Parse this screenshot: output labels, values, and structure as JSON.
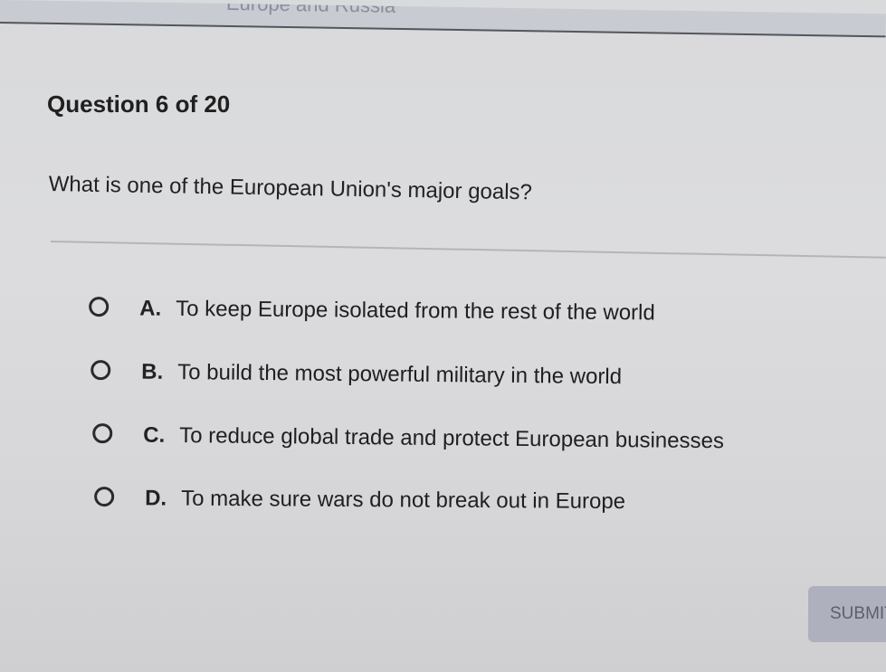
{
  "header": {
    "title": "Europe and Russia"
  },
  "question": {
    "counter": "Question 6 of 20",
    "text": "What is one of the European Union's major goals?"
  },
  "options": [
    {
      "letter": "A.",
      "text": "To keep Europe isolated from the rest of the world"
    },
    {
      "letter": "B.",
      "text": "To build the most powerful military in the world"
    },
    {
      "letter": "C.",
      "text": "To reduce global trade and protect European businesses"
    },
    {
      "letter": "D.",
      "text": "To make sure wars do not break out in Europe"
    }
  ],
  "submit": {
    "label": "SUBMIT"
  }
}
